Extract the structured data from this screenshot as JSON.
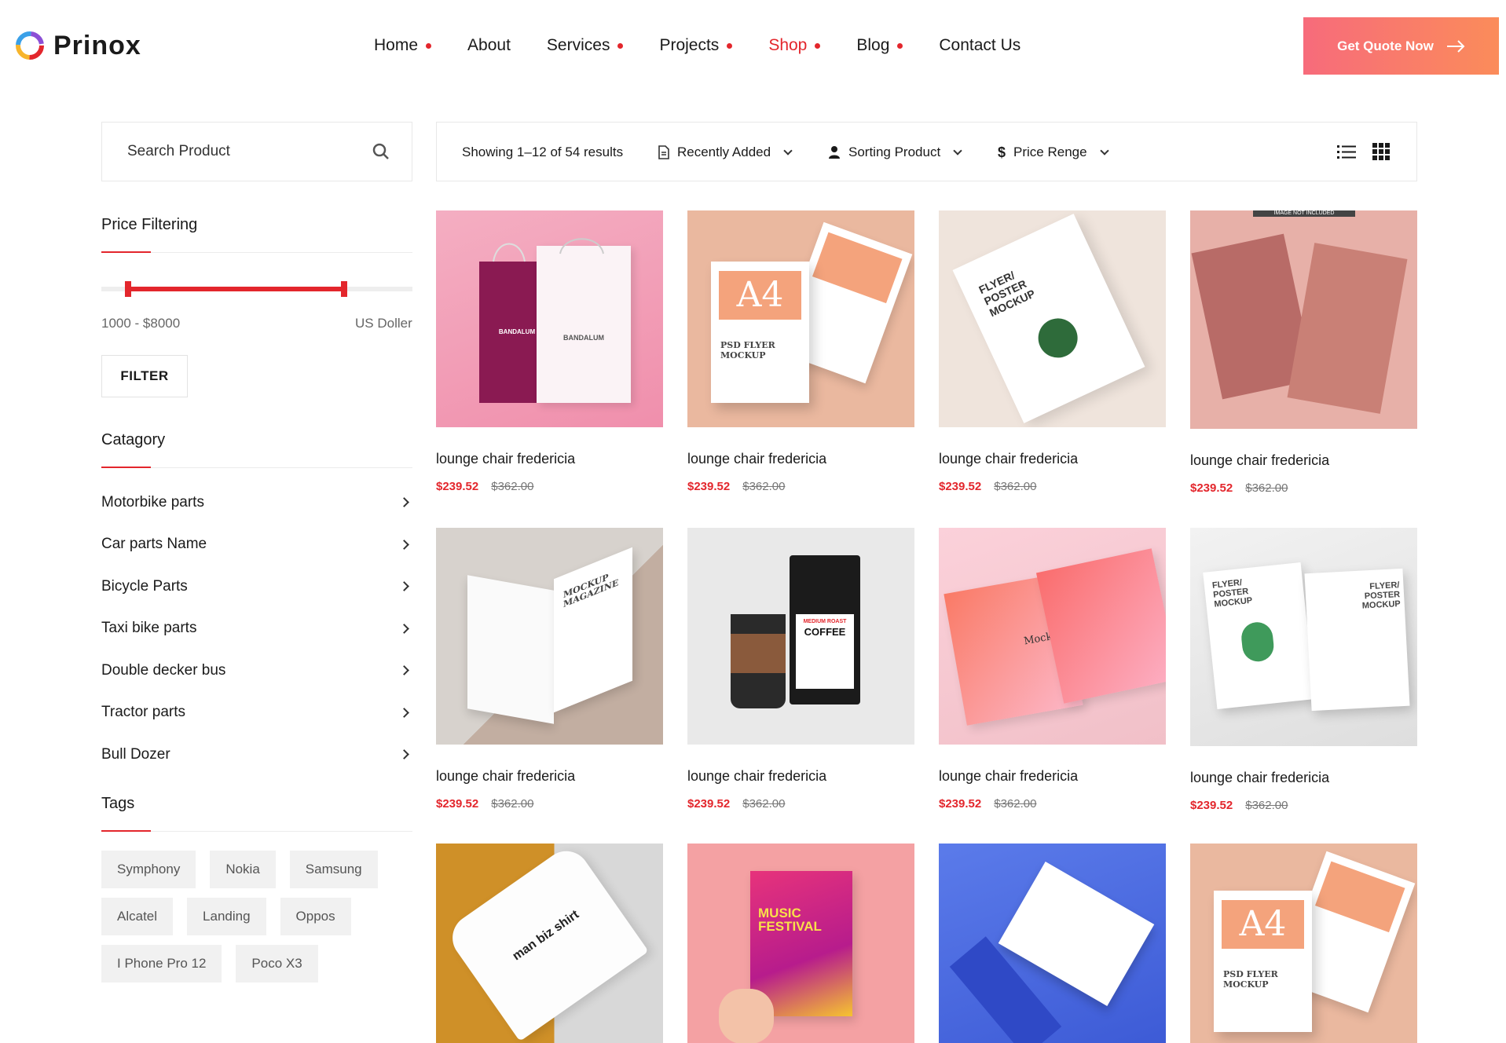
{
  "brand": {
    "name": "Prinox"
  },
  "nav": {
    "items": [
      {
        "label": "Home",
        "dot": true,
        "active": false
      },
      {
        "label": "About",
        "dot": false,
        "active": false
      },
      {
        "label": "Services",
        "dot": true,
        "active": false
      },
      {
        "label": "Projects",
        "dot": true,
        "active": false
      },
      {
        "label": "Shop",
        "dot": true,
        "active": true
      },
      {
        "label": "Blog",
        "dot": true,
        "active": false
      },
      {
        "label": "Contact Us",
        "dot": false,
        "active": false
      }
    ],
    "cta_label": "Get Quote Now"
  },
  "sidebar": {
    "search_placeholder": "Search Product",
    "price": {
      "title": "Price Filtering",
      "range_text": "1000 - $8000",
      "unit": "US Doller",
      "filter_label": "FILTER",
      "range_min_fraction": 0.085,
      "range_max_fraction": 0.78
    },
    "category": {
      "title": "Catagory",
      "items": [
        "Motorbike parts",
        "Car parts Name",
        "Bicycle Parts",
        "Taxi bike parts",
        "Double decker bus",
        "Tractor parts",
        "Bull Dozer"
      ]
    },
    "tags": {
      "title": "Tags",
      "items": [
        "Symphony",
        "Nokia",
        "Samsung",
        "Alcatel",
        "Landing",
        "Oppos",
        "I Phone Pro 12",
        "Poco X3"
      ]
    }
  },
  "toolbar": {
    "results": "Showing 1–12 of 54 results",
    "recent": "Recently Added",
    "sorting": "Sorting Product",
    "price_range": "Price Renge"
  },
  "products": [
    {
      "name": "lounge chair fredericia",
      "price": "$239.52",
      "old_price": "$362.00"
    },
    {
      "name": "lounge chair fredericia",
      "price": "$239.52",
      "old_price": "$362.00"
    },
    {
      "name": "lounge chair fredericia",
      "price": "$239.52",
      "old_price": "$362.00"
    },
    {
      "name": "lounge chair fredericia",
      "price": "$239.52",
      "old_price": "$362.00"
    },
    {
      "name": "lounge chair fredericia",
      "price": "$239.52",
      "old_price": "$362.00"
    },
    {
      "name": "lounge chair fredericia",
      "price": "$239.52",
      "old_price": "$362.00"
    },
    {
      "name": "lounge chair fredericia",
      "price": "$239.52",
      "old_price": "$362.00"
    },
    {
      "name": "lounge chair fredericia",
      "price": "$239.52",
      "old_price": "$362.00"
    },
    {
      "name": "",
      "price": "",
      "old_price": ""
    },
    {
      "name": "",
      "price": "",
      "old_price": ""
    },
    {
      "name": "",
      "price": "",
      "old_price": ""
    },
    {
      "name": "",
      "price": "",
      "old_price": ""
    }
  ],
  "image_text": {
    "bag_brand": "BANDALUM",
    "psd_flyer": "PSD FLYER MOCKUP",
    "a4": "A4",
    "flyer_poster": "FLYER/ POSTER MOCKUP",
    "image_not_included": "IMAGE NOT INCLUDED",
    "mockup_magazine": "MOCKUP MAGAZINE",
    "medium_roast": "MEDIUM ROAST",
    "coffee": "COFFEE",
    "mockup": "Mockup",
    "music_festival": "MUSIC FESTIVAL",
    "tshirt_text": "man biz shirt"
  },
  "colors": {
    "accent": "#e3262c",
    "cta_start": "#f76b7b",
    "cta_end": "#fb8c5a"
  }
}
